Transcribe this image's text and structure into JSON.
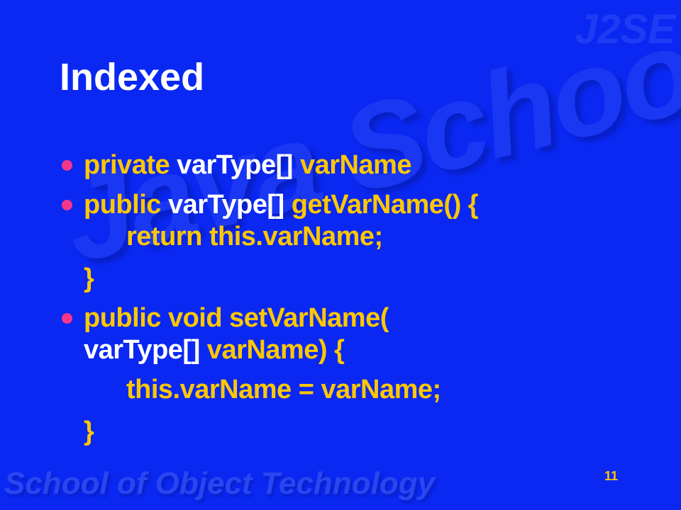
{
  "watermarks": {
    "corner": "J2SE",
    "center": "Java School",
    "footer": "School of Object Technology"
  },
  "title": "Indexed",
  "bullets": [
    {
      "segments": [
        "private",
        " varType[]",
        " varName"
      ]
    },
    {
      "segments": [
        "public",
        " varType[]",
        " getVarName() {"
      ],
      "lines": [
        "return this.varName;",
        "}"
      ]
    },
    {
      "segments": [
        "public void setVarName("
      ],
      "lines": [
        "varType[]",
        " varName) {",
        "this.varName = varName;",
        "}"
      ]
    }
  ],
  "page_number": "11",
  "colors": {
    "background": "#0a28f2",
    "keyword": "#ffc800",
    "type": "#ffffff",
    "bullet": "#f5378c"
  }
}
